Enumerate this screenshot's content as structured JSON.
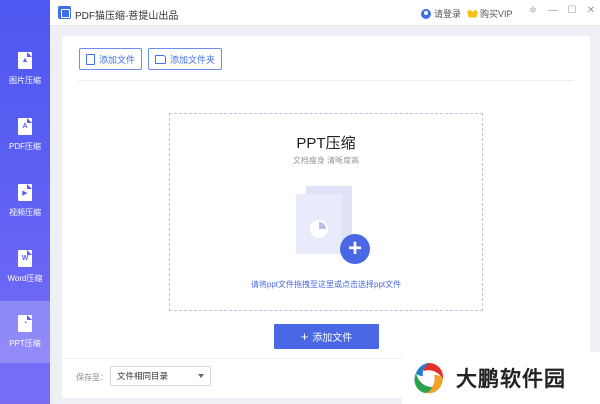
{
  "window": {
    "title": "PDF猫压缩-菩提山出品",
    "login_label": "请登录",
    "vip_label": "购买VIP",
    "controls": [
      "≑",
      "—",
      "☐",
      "✕"
    ]
  },
  "sidebar": {
    "items": [
      {
        "label": "图片压缩",
        "icon": "image-file-icon",
        "glyph": "▲"
      },
      {
        "label": "PDF压缩",
        "icon": "pdf-file-icon",
        "glyph": "A"
      },
      {
        "label": "视频压缩",
        "icon": "video-file-icon",
        "glyph": "▶"
      },
      {
        "label": "Word压缩",
        "icon": "word-file-icon",
        "glyph": "W"
      },
      {
        "label": "PPT压缩",
        "icon": "ppt-file-icon",
        "glyph": "◔"
      }
    ],
    "active_index": 4
  },
  "toolbar": {
    "add_file_label": "添加文件",
    "add_folder_label": "添加文件夹"
  },
  "dropzone": {
    "title": "PPT压缩",
    "subtitle": "文档瘦身 清晰度高",
    "hint": "请将ppt文件拖拽至这里或点击选择ppt文件"
  },
  "primary_button": {
    "label": "添加文件"
  },
  "save": {
    "label": "保存至：",
    "selected": "文件相同目录"
  },
  "watermark": {
    "text": "大鹏软件园"
  },
  "colors": {
    "accent": "#4a68e4",
    "sidebar": "#5b5ff3"
  }
}
